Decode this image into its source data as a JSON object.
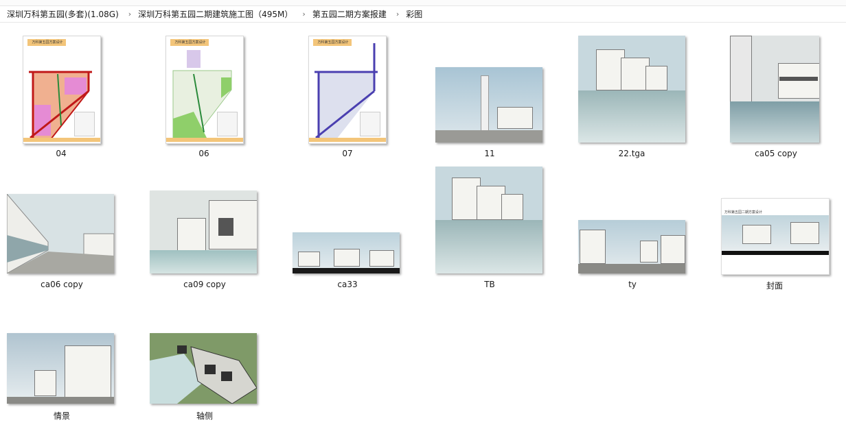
{
  "breadcrumb": {
    "items": [
      "深圳万科第五园(多套)(1.08G)",
      "深圳万科第五园二期建筑施工图（495M）",
      "第五园二期方案报建",
      "彩图"
    ]
  },
  "files": [
    {
      "name": "04",
      "kind": "plan-red"
    },
    {
      "name": "06",
      "kind": "plan-green"
    },
    {
      "name": "07",
      "kind": "plan-blue"
    },
    {
      "name": "11",
      "kind": "street"
    },
    {
      "name": "22.tga",
      "kind": "water-villa"
    },
    {
      "name": "ca05 copy",
      "kind": "courtyard"
    },
    {
      "name": "ca06 copy",
      "kind": "plaza"
    },
    {
      "name": "ca09 copy",
      "kind": "pool"
    },
    {
      "name": "ca33",
      "kind": "panorama"
    },
    {
      "name": "TB",
      "kind": "water-villa-tall"
    },
    {
      "name": "ty",
      "kind": "street-wide"
    },
    {
      "name": "封面",
      "kind": "cover"
    },
    {
      "name": "情景",
      "kind": "scene"
    },
    {
      "name": "轴侧",
      "kind": "axon"
    }
  ],
  "plan_banner_text": "万科第五园方案设计",
  "cover_title": "万科第五园二期方案设计",
  "colors": {
    "plan_banner": "#f3c57a",
    "road_red": "#c01818",
    "road_blue": "#4a3fb0",
    "park_green": "#8fcf6a"
  }
}
